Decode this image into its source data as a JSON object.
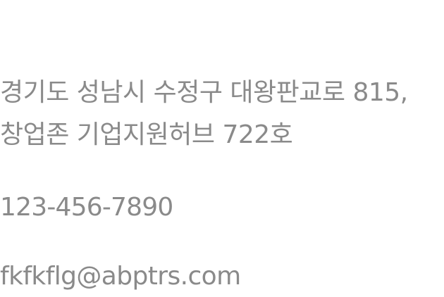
{
  "contact": {
    "address_line_1": "경기도 성남시 수정구 대왕판교로 815,",
    "address_line_2": "창업존 기업지원허브 722호",
    "phone": "123-456-7890",
    "email": "fkfkflg@abptrs.com"
  }
}
